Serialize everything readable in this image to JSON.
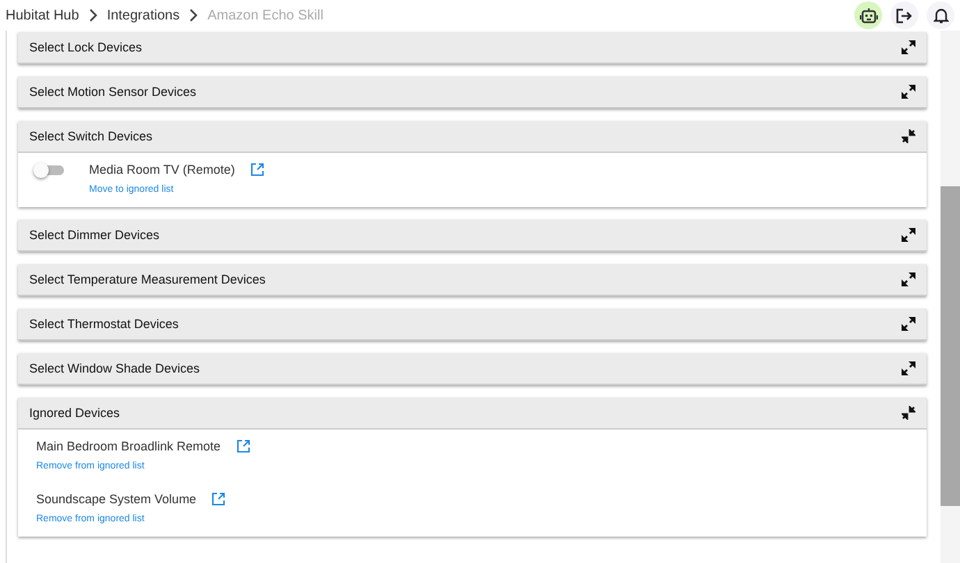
{
  "breadcrumbs": [
    {
      "label": "Hubitat Hub",
      "current": false
    },
    {
      "label": "Integrations",
      "current": false
    },
    {
      "label": "Amazon Echo Skill",
      "current": true
    }
  ],
  "header_actions": [
    {
      "kind": "robot",
      "selected": true
    },
    {
      "kind": "logout",
      "selected": false
    },
    {
      "kind": "bell",
      "selected": false
    }
  ],
  "panels": [
    {
      "title": "Select Lock Devices",
      "expanded": false
    },
    {
      "title": "Select Motion Sensor Devices",
      "expanded": false
    },
    {
      "title": "Select Switch Devices",
      "expanded": true,
      "devices": [
        {
          "kind": "toggle",
          "name": "Media Room TV (Remote)",
          "on": false,
          "action": "Move to ignored list"
        }
      ]
    },
    {
      "title": "Select Dimmer Devices",
      "expanded": false
    },
    {
      "title": "Select Temperature Measurement Devices",
      "expanded": false
    },
    {
      "title": "Select Thermostat Devices",
      "expanded": false
    },
    {
      "title": "Select Window Shade Devices",
      "expanded": false
    },
    {
      "title": "Ignored Devices",
      "expanded": true,
      "devices": [
        {
          "kind": "ignored",
          "name": "Main Bedroom Broadlink Remote",
          "action": "Remove from ignored list"
        },
        {
          "kind": "ignored",
          "name": "Soundscape System Volume",
          "action": "Remove from ignored list"
        }
      ]
    }
  ]
}
